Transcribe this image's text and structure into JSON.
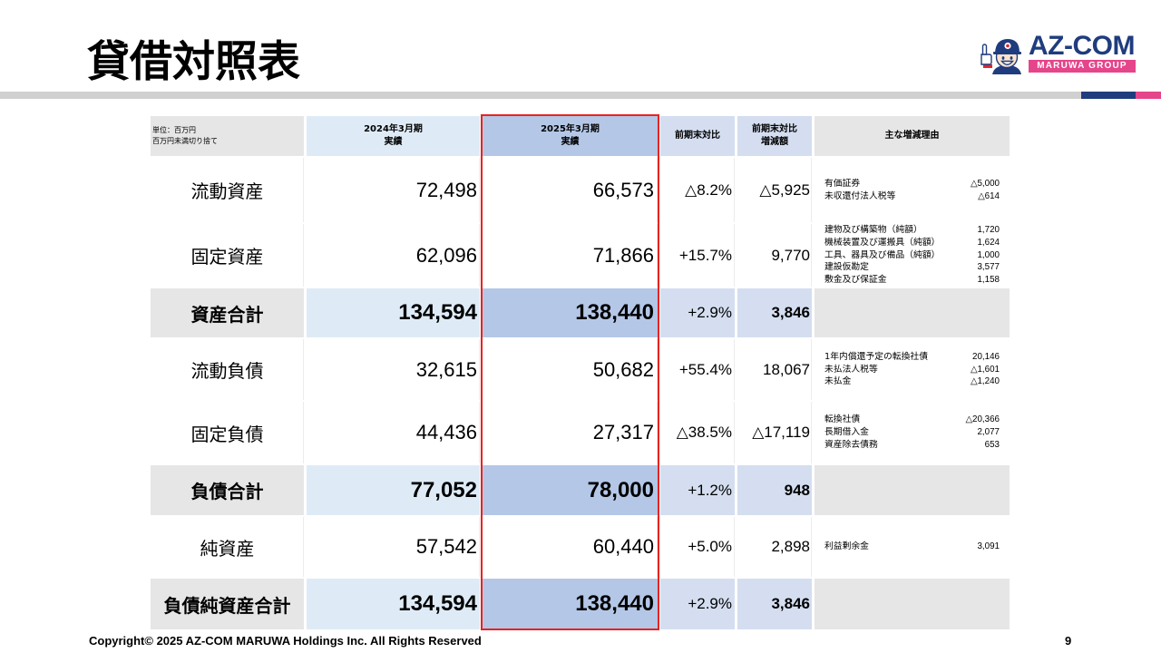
{
  "slide": {
    "title": "貸借対照表",
    "copyright": "Copyright© 2025 AZ-COM MARUWA Holdings Inc. All Rights Reserved",
    "page_number": "9"
  },
  "logo": {
    "brand": "AZ-COM",
    "group": "MARUWA GROUP",
    "icon": "mascot-thumbs-up-icon"
  },
  "colors": {
    "brand_navy": "#1f3c7e",
    "brand_pink": "#e5458a",
    "rule_gray": "#d0d0d0",
    "highlight_frame": "#e8231f",
    "cell_gray": "#e7e6e6",
    "prev_blue": "#deebf7",
    "curr_blue": "#b4c7e7",
    "compare_blue": "#d4def0"
  },
  "table": {
    "header": {
      "unit": [
        "単位：百万円",
        "百万円未満切り捨て"
      ],
      "prev": [
        "2024年3月期",
        "実績"
      ],
      "curr": [
        "2025年3月期",
        "実績"
      ],
      "ratio": "前期末対比",
      "diff": [
        "前期末対比",
        "増減額"
      ],
      "reasons": "主な増減理由"
    },
    "rows": [
      {
        "label": "流動資産",
        "prev": "72,498",
        "curr": "66,573",
        "ratio": "△8.2%",
        "diff": "△5,925",
        "reasons": [
          {
            "item": "有価証券",
            "amount": "△5,000"
          },
          {
            "item": "未収還付法人税等",
            "amount": "△614"
          }
        ]
      },
      {
        "label": "固定資産",
        "prev": "62,096",
        "curr": "71,866",
        "ratio": "+15.7%",
        "diff": "9,770",
        "reasons": [
          {
            "item": "建物及び構築物（純額）",
            "amount": "1,720"
          },
          {
            "item": "機械装置及び運搬具（純額）",
            "amount": "1,624"
          },
          {
            "item": "工具、器具及び備品（純額）",
            "amount": "1,000"
          },
          {
            "item": "建設仮勘定",
            "amount": "3,577"
          },
          {
            "item": "敷金及び保証金",
            "amount": "1,158"
          }
        ]
      },
      {
        "label": "資産合計",
        "prev": "134,594",
        "curr": "138,440",
        "ratio": "+2.9%",
        "diff": "3,846"
      },
      {
        "label": "流動負債",
        "prev": "32,615",
        "curr": "50,682",
        "ratio": "+55.4%",
        "diff": "18,067",
        "reasons": [
          {
            "item": "1年内償還予定の転換社債",
            "amount": "20,146"
          },
          {
            "item": "未払法人税等",
            "amount": "△1,601"
          },
          {
            "item": "未払金",
            "amount": "△1,240"
          }
        ]
      },
      {
        "label": "固定負債",
        "prev": "44,436",
        "curr": "27,317",
        "ratio": "△38.5%",
        "diff": "△17,119",
        "reasons": [
          {
            "item": "転換社債",
            "amount": "△20,366"
          },
          {
            "item": "長期借入金",
            "amount": "2,077"
          },
          {
            "item": "資産除去債務",
            "amount": "653"
          }
        ]
      },
      {
        "label": "負債合計",
        "prev": "77,052",
        "curr": "78,000",
        "ratio": "+1.2%",
        "diff": "948"
      },
      {
        "label": "純資産",
        "prev": "57,542",
        "curr": "60,440",
        "ratio": "+5.0%",
        "diff": "2,898",
        "reasons": [
          {
            "item": "利益剰余金",
            "amount": "3,091"
          }
        ]
      },
      {
        "label": "負債純資産合計",
        "prev": "134,594",
        "curr": "138,440",
        "ratio": "+2.9%",
        "diff": "3,846"
      }
    ]
  }
}
